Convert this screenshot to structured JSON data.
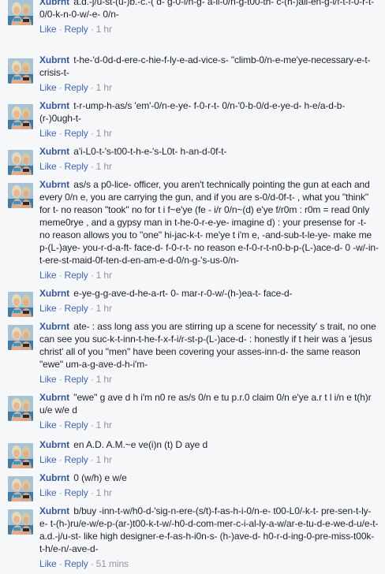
{
  "action_labels": {
    "like": "Like",
    "reply": "Reply",
    "separator": "·"
  },
  "comments": [
    {
      "author": "Xubrnt",
      "text": "a.d.-j/u-st-(u-)b.-c.-( d- g-0-i/n-g- a-ll-0/n-g-t00-th- c-(h-)all-en-g-i/f-t-f-0-r-t- 0/0-k-n-0-w/-e- 0/n-",
      "time": "1 hr"
    },
    {
      "author": "Xubrnt",
      "text": "t-he-'d-0d-d-ere-c-hie-f-ly-e-ad-vice-s- \"climb-0/n-e-me'ye-necessary-e-t- crisis-t-",
      "time": "1 hr"
    },
    {
      "author": "Xubrnt",
      "text": "t-r-ump-h-as/s 'em'-0/n-e-ye- f-0-r-t- 0/n-'0-b-0/d-e-ye-d- h-e/a-d-b-(r-)0ugh-t-",
      "time": "1 hr"
    },
    {
      "author": "Xubrnt",
      "text": "a'i-L0-t-'s-t00-t-h-e-'s-L0t- h-an-d-0f-t-",
      "time": "1 hr"
    },
    {
      "author": "Xubrnt",
      "text": "as/s a p0-lice- officer, you aren't technically pointing the gun at each and every 0/n e, you are carrying the gun, and if you are s-0/d-0f-t- , what you \"think\" for t- no reason \"took\" no for t i f~e'ye (fe - i/r 0/n~(d) e'ye f/r0m : r0m = read 0nly meme0ryе , and a gypsy man in t-he-0-r-e-ye- imagine d) : your presense for -t- no reason allows you to \"one\" hi-jac-k-t- me'ye t i'm e, -and-sub-t-le-ye- make me p-(L-)aye- you-r-d-a-ft- face-d- f-0-r-t- no reason e-f-0-r-t-n0-b-p-(L-)ace-d- 0 -w/-in-t-ere-st-maid-0f-ten-d-en-am-e-d-0/n-g-'s-us-0/n-",
      "time": "1 hr"
    },
    {
      "author": "Xubrnt",
      "text": "e-ye-g-g-ave-d-he-a-rt- 0- mar-r-0-w/-(h-)ea-t- face-d-",
      "time": "1 hr"
    },
    {
      "author": "Xubrnt",
      "text": "ate- : ass long ass you are stirring up a scene for necessity' s trait, no one can see you suc-k-t-inn-t-he-f-x-f-i/r-st-p-(L-)ace-d- : honestly if t heir was a 'jesus christ' all of you \"men\" have been covering your asses-inn-d- the same reason \"ewe\" um-a-g-ave-d-h-i'm-",
      "time": "1 hr"
    },
    {
      "author": "Xubrnt",
      "text": "\"ewe\" g ave d h i'm n0 re as/s 0/n e tu p.r.0 claim 0/n e'ye a.r t l i/n e t(h)r u/e w/e d",
      "time": "1 hr"
    },
    {
      "author": "Xubrnt",
      "text": "en A.D. A.M.~e ve(i)n (t) D aye d",
      "time": "1 hr"
    },
    {
      "author": "Xubrnt",
      "text": "0 (w/h) e w/e",
      "time": "1 hr"
    },
    {
      "author": "Xubrnt",
      "text": "b/buy -inn-t-w/h0-d-'sig-n-ere-(s/t)-f-as-h-i-0/n-e- t00-L0/-k-t- pre-sen-t-ly-e- t-(h-)ru/e-w/e-p-(ar-)t00-k-t-w/-h0-d-com-mer-c-i-al-ly-a-w/ar-e-tu-d-e-we-d-u/e-t- a.d.-j/u-st- like high designer-e-f-as-h-i0n-s- (h-)ave-d- h0-r-d-ing-0-pre-miss-t00k-t-h/e-n/-ave-d-",
      "time": "51 mins"
    }
  ]
}
